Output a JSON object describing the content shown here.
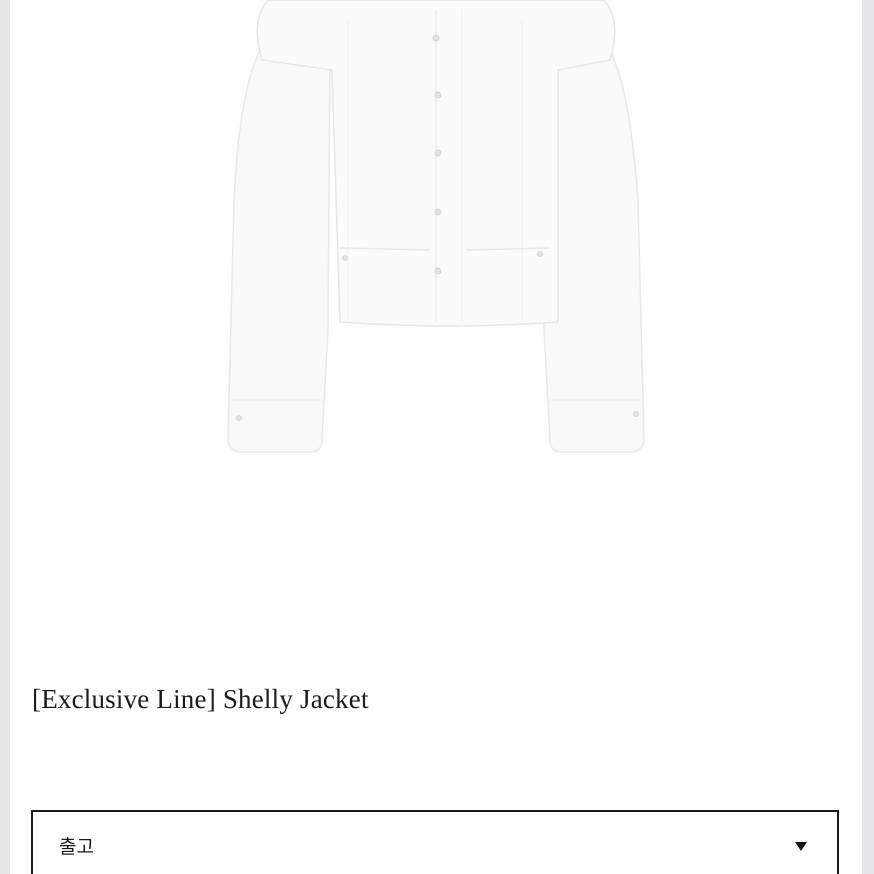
{
  "product": {
    "title": "[Exclusive Line] Shelly Jacket",
    "image_subject": "white cropped jacket with pearl buttons"
  },
  "option_select": {
    "selected_value": "출고",
    "icon": "chevron-down-icon"
  }
}
